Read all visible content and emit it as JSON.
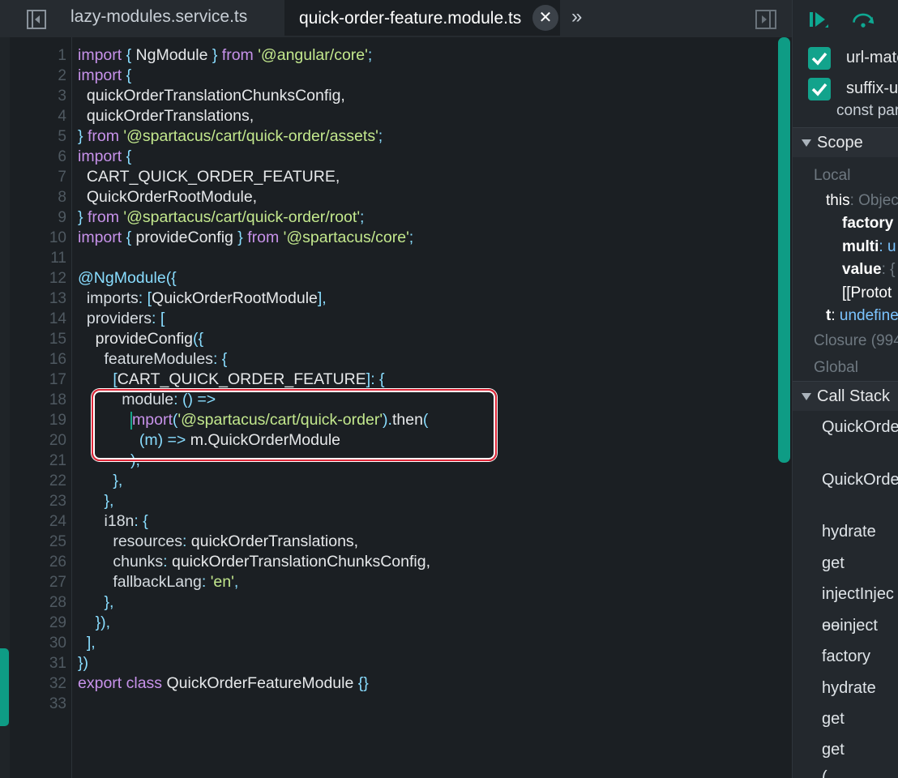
{
  "tabs": {
    "inactive_label": "lazy-modules.service.ts",
    "active_label": "quick-order-feature.module.ts",
    "close_symbol": "✕",
    "overflow_symbol": "»"
  },
  "code": {
    "lines": [
      {
        "n": "1"
      },
      {
        "n": "2"
      },
      {
        "n": "3"
      },
      {
        "n": "4"
      },
      {
        "n": "5"
      },
      {
        "n": "6"
      },
      {
        "n": "7"
      },
      {
        "n": "8"
      },
      {
        "n": "9"
      },
      {
        "n": "10"
      },
      {
        "n": "11"
      },
      {
        "n": "12"
      },
      {
        "n": "13"
      },
      {
        "n": "14"
      },
      {
        "n": "15"
      },
      {
        "n": "16"
      },
      {
        "n": "17"
      },
      {
        "n": "18"
      },
      {
        "n": "19"
      },
      {
        "n": "20"
      },
      {
        "n": "21"
      },
      {
        "n": "22"
      },
      {
        "n": "23"
      },
      {
        "n": "24"
      },
      {
        "n": "25"
      },
      {
        "n": "26"
      },
      {
        "n": "27"
      },
      {
        "n": "28"
      },
      {
        "n": "29"
      },
      {
        "n": "30"
      },
      {
        "n": "31"
      },
      {
        "n": "32"
      },
      {
        "n": "33"
      }
    ],
    "t": {
      "import": "import",
      "from": "from",
      "brace_open": "{",
      "brace_close": "}",
      "ngmodule": " NgModule ",
      "angular_core": "'@angular/core'",
      "semi": ";",
      "chunks_config": "quickOrderTranslationChunksConfig,",
      "translations": "quickOrderTranslations,",
      "qo_assets": "'@spartacus/cart/quick-order/assets'",
      "cart_feature": "CART_QUICK_ORDER_FEATURE,",
      "root_module": "QuickOrderRootModule,",
      "qo_root": "'@spartacus/cart/quick-order/root'",
      "provide_config": " provideConfig ",
      "sp_core": "'@spartacus/core'",
      "decorator": "@NgModule",
      "paren_brace": "({",
      "imports_key": "imports",
      "imports_val": "QuickOrderRootModule",
      "providers_key": "providers",
      "provide_config_call": "provideConfig",
      "feature_modules": "featureModules",
      "cart_feature_key": "CART_QUICK_ORDER_FEATURE",
      "module_key": "module",
      "arrow_fn": "() =>",
      "mport": "mport",
      "qo_path": "'@spartacus/cart/quick-order'",
      "then": "then",
      "m_param": "(m)",
      "arrow": "=>",
      "m_access": " m.QuickOrderModule",
      "i18n_key": "i18n",
      "resources_key": "resources",
      "resources_val": " quickOrderTranslations,",
      "chunks_key": "chunks",
      "chunks_val": " quickOrderTranslationChunksConfig,",
      "fallback_key": "fallbackLang",
      "fallback_val": "'en'",
      "export": "export",
      "class": "class",
      "class_name": " QuickOrderFeatureModule ",
      "empty_obj": "{}"
    }
  },
  "debugger": {
    "breakpoints": [
      {
        "label": "url-matc",
        "checked": true
      },
      {
        "label": "suffix-u",
        "checked": true
      }
    ],
    "breakpoint_sub": "const par",
    "scope_title": "Scope",
    "scope": {
      "local": "Local",
      "this_label": "this",
      "this_value": ": Objec",
      "factory": "factory",
      "multi": "multi",
      "multi_value": ": u",
      "value": "value",
      "value_value": ": {",
      "prototype": "[[Protot",
      "t_label": "t",
      "t_value": "undefine",
      "closure": "Closure (994",
      "global": "Global"
    },
    "callstack_title": "Call Stack",
    "callstack": [
      "QuickOrde",
      "QuickOrde",
      "hydrate",
      "get",
      "injectInjec",
      "ɵɵinject",
      "factory",
      "hydrate",
      "get",
      "get",
      "("
    ]
  },
  "colors": {
    "accent": "#0e9c85",
    "highlight_border": "#e02638",
    "keyword": "#c792ea",
    "string": "#c3e88d",
    "punct": "#89ddff"
  }
}
